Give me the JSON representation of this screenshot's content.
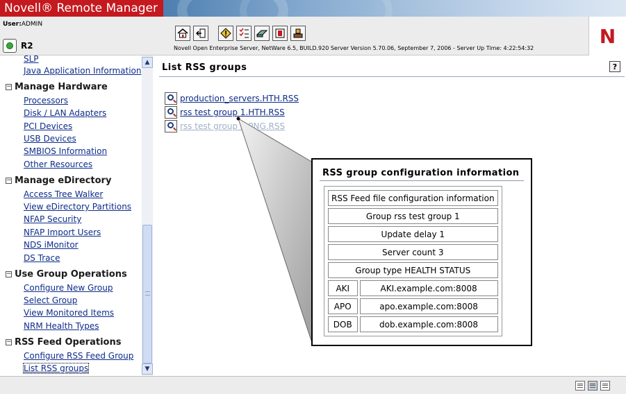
{
  "header": {
    "brand": "Novell® Remote Manager",
    "user_label": "User:",
    "user_name": "ADMIN",
    "server_name": "R2",
    "server_info": "Novell Open Enterprise Server, NetWare 6.5, BUILD.920  Server Version 5.70.06, September 7, 2006 - Server Up Time: 4:22:54:32",
    "logo_letter": "N",
    "toolbar_icons": [
      "home-icon",
      "exit-icon",
      "health-icon",
      "config-icon",
      "volumes-icon",
      "info-icon",
      "tools-icon"
    ]
  },
  "sidebar": {
    "top_links": [
      {
        "label": "SLP"
      },
      {
        "label": "Java Application Information"
      }
    ],
    "groups": [
      {
        "heading": "Manage Hardware",
        "links": [
          "Processors",
          "Disk / LAN Adapters",
          "PCI Devices",
          "USB Devices",
          "SMBIOS Information",
          "Other Resources"
        ]
      },
      {
        "heading": "Manage eDirectory",
        "links": [
          "Access Tree Walker",
          "View eDirectory Partitions",
          "NFAP Security",
          "NFAP Import Users",
          "NDS iMonitor",
          "DS Trace"
        ]
      },
      {
        "heading": "Use Group Operations",
        "links": [
          "Configure New Group",
          "Select Group",
          "View Monitored Items",
          "NRM Health Types"
        ]
      },
      {
        "heading": "RSS Feed Operations",
        "links": [
          "Configure RSS Feed Group",
          "List RSS groups"
        ]
      }
    ],
    "collapse_symbol": "−",
    "current_link": "List RSS groups"
  },
  "main": {
    "title": "List RSS groups",
    "help_symbol": "?",
    "rss_files": [
      "production_servers.HTH.RSS",
      "rss test group 1.HTH.RSS",
      "rss test group 2.PNG.RSS"
    ]
  },
  "config": {
    "title": "RSS group configuration information",
    "rows": [
      "RSS Feed file configuration information",
      "Group rss test group 1",
      "Update delay 1",
      "Server count 3",
      "Group type HEALTH STATUS"
    ],
    "servers": [
      {
        "name": "AKI",
        "address": "AKI.example.com:8008"
      },
      {
        "name": "APO",
        "address": "apo.example.com:8008"
      },
      {
        "name": "DOB",
        "address": "dob.example.com:8008"
      }
    ]
  },
  "colors": {
    "brand_red": "#c4191f",
    "link_blue": "#0d2c8a",
    "server_status_green": "#35a83a"
  }
}
